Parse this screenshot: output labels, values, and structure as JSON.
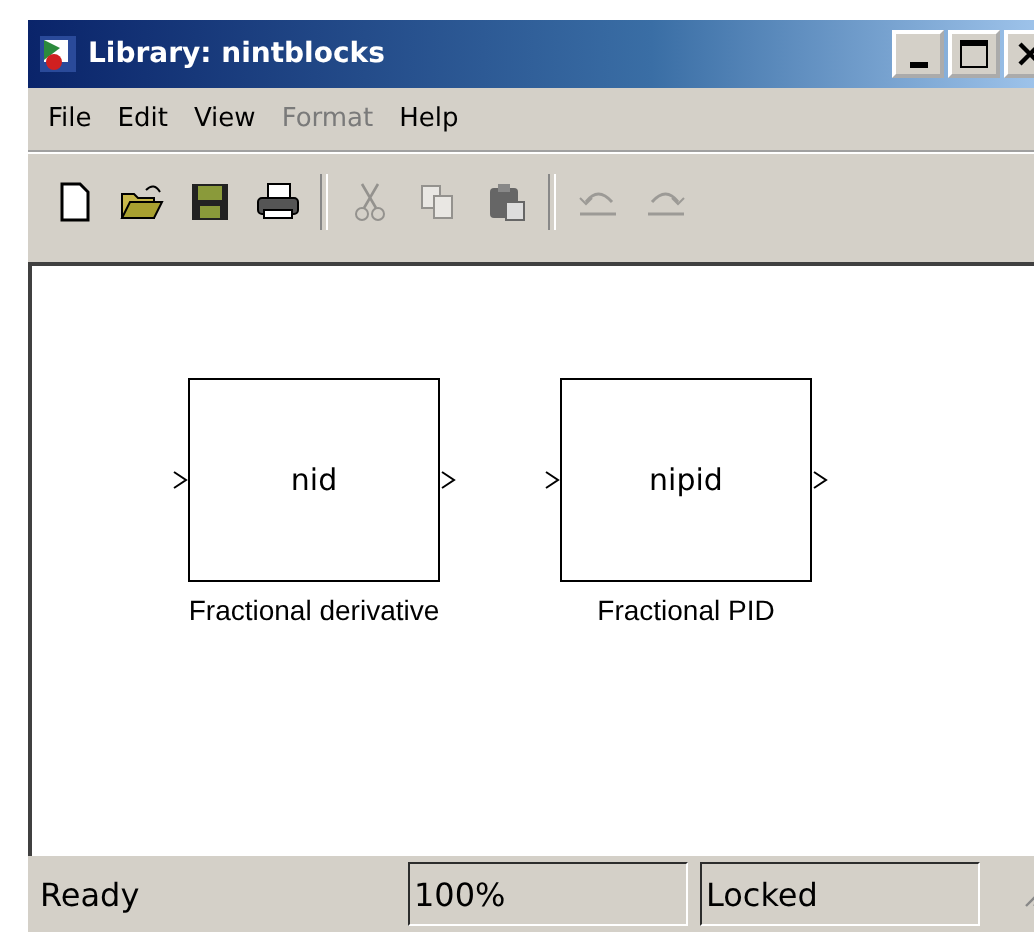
{
  "window": {
    "title": "Library: nintblocks"
  },
  "menu": [
    {
      "label": "File",
      "disabled": false
    },
    {
      "label": "Edit",
      "disabled": false
    },
    {
      "label": "View",
      "disabled": false
    },
    {
      "label": "Format",
      "disabled": true
    },
    {
      "label": "Help",
      "disabled": false
    }
  ],
  "toolbar": [
    {
      "kind": "new",
      "disabled": false
    },
    {
      "kind": "open",
      "disabled": false
    },
    {
      "kind": "save",
      "disabled": false
    },
    {
      "kind": "print",
      "disabled": false
    },
    {
      "kind": "separator"
    },
    {
      "kind": "cut",
      "disabled": true
    },
    {
      "kind": "copy",
      "disabled": true
    },
    {
      "kind": "paste",
      "disabled": false
    },
    {
      "kind": "separator"
    },
    {
      "kind": "undo",
      "disabled": true
    },
    {
      "kind": "redo",
      "disabled": true
    }
  ],
  "blocks": [
    {
      "name": "nid",
      "label": "Fractional derivative"
    },
    {
      "name": "nipid",
      "label": "Fractional PID"
    }
  ],
  "status_bar": {
    "state": "Ready",
    "zoom": "100%",
    "lock": "Locked"
  }
}
